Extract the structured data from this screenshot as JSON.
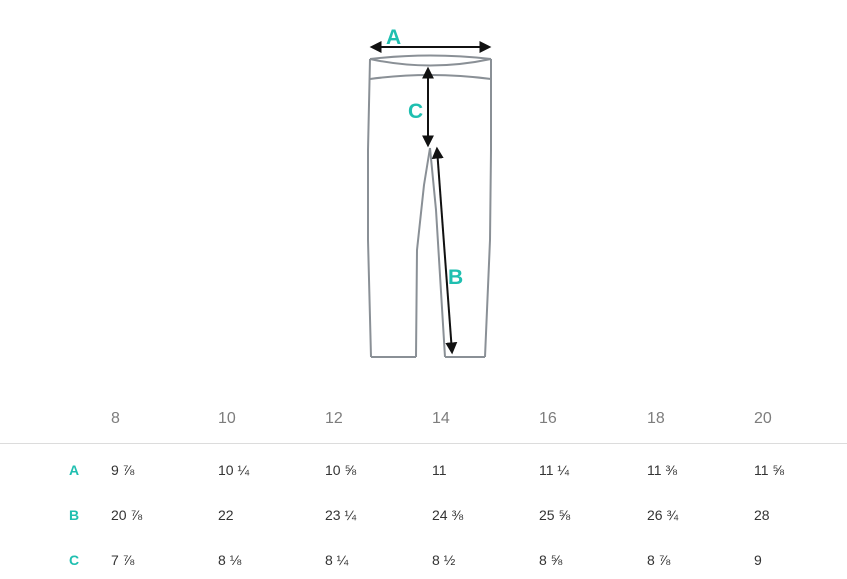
{
  "colors": {
    "accent": "#1fbfb0",
    "outline": "#8a9096",
    "arrow": "#111111",
    "text": "#333333",
    "header_text": "#7d7d7d"
  },
  "diagram": {
    "labels": {
      "a": "A",
      "b": "B",
      "c": "C"
    }
  },
  "table": {
    "sizes": [
      "8",
      "10",
      "12",
      "14",
      "16",
      "18",
      "20"
    ],
    "rows": [
      {
        "label": "A",
        "values": [
          "9 ⅞",
          "10 ¼",
          "10 ⅝",
          "11",
          "11 ¼",
          "11 ⅜",
          "11 ⅝"
        ]
      },
      {
        "label": "B",
        "values": [
          "20 ⅞",
          "22",
          "23 ¼",
          "24 ⅜",
          "25 ⅝",
          "26 ¾",
          "28"
        ]
      },
      {
        "label": "C",
        "values": [
          "7 ⅞",
          "8 ⅛",
          "8 ¼",
          "8 ½",
          "8 ⅝",
          "8 ⅞",
          "9"
        ]
      }
    ]
  }
}
